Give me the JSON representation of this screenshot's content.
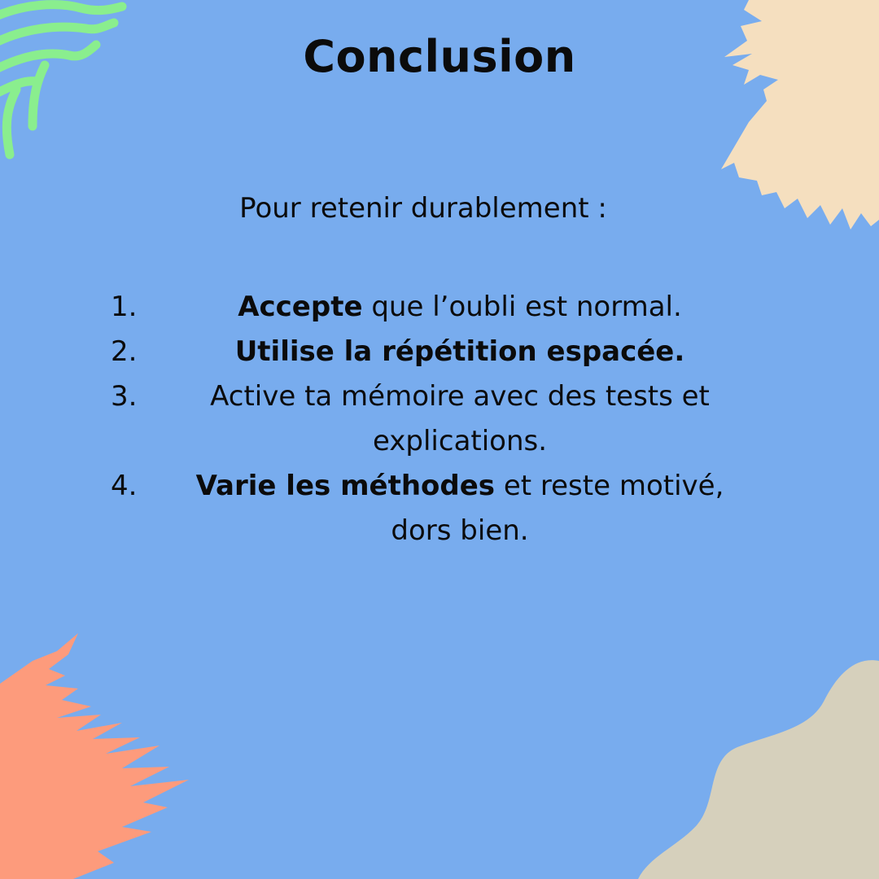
{
  "slide": {
    "title": "Conclusion",
    "intro": "Pour retenir durablement :",
    "items": [
      {
        "number": "1.",
        "bold": "Accepte",
        "rest": " que l’oubli est normal."
      },
      {
        "number": "2.",
        "bold": "Utilise la répétition espacée.",
        "rest": ""
      },
      {
        "number": "3.",
        "bold": "",
        "rest": "Active ta mémoire avec des tests et explications."
      },
      {
        "number": "4.",
        "bold": "Varie les méthodes",
        "rest": " et reste motivé, dors bien."
      }
    ]
  },
  "colors": {
    "background": "#78acee",
    "green_strokes": "#8aee8e",
    "cream_splash": "#f5dfbf",
    "orange_brush": "#fd9b7c",
    "grey_blob": "#d6d0bc",
    "text": "#0b0b0b"
  }
}
